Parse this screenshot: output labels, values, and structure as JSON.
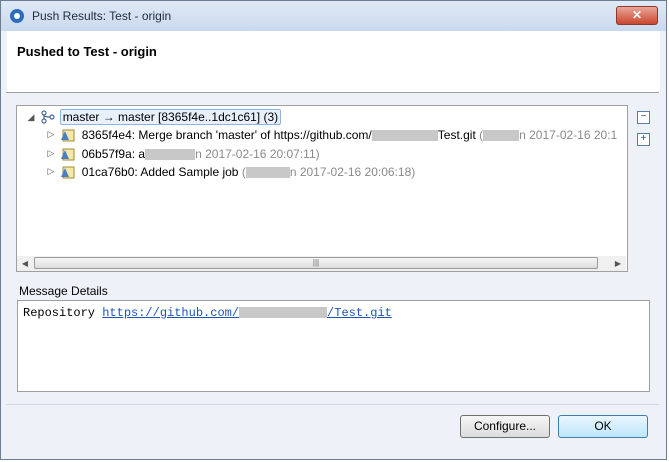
{
  "window": {
    "title": "Push Results: Test - origin",
    "close_label": "✕"
  },
  "header": {
    "title": "Pushed to Test - origin"
  },
  "tree": {
    "root": {
      "twisty": "◢",
      "label": "master → master [8365f4e..1dc1c61] (3)"
    },
    "commits": [
      {
        "twisty": "▷",
        "text": "8365f4e4: Merge branch 'master' of https://github.com/",
        "text_after": "Test.git",
        "meta": "(",
        "meta_after": "n 2017-02-16 20:1"
      },
      {
        "twisty": "▷",
        "text": "06b57f9a: a",
        "meta_after": "n 2017-02-16 20:07:11)"
      },
      {
        "twisty": "▷",
        "text": "01ca76b0: Added Sample job",
        "meta": "(",
        "meta_after": "n 2017-02-16 20:06:18)"
      }
    ]
  },
  "scrollbar": {
    "left_arrow": "◀",
    "right_arrow": "▶",
    "grip": "|||"
  },
  "side_buttons": {
    "collapse": "−",
    "expand": "+"
  },
  "message": {
    "label": "Message Details",
    "prefix": "Repository ",
    "link_start": "https://github.com/",
    "link_end": "/Test.git"
  },
  "buttons": {
    "configure": "Configure...",
    "ok": "OK"
  }
}
